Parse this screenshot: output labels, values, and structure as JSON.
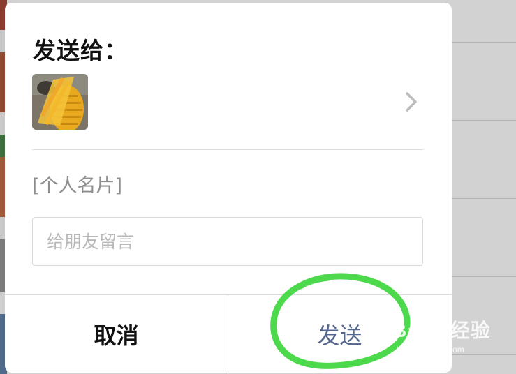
{
  "dialog": {
    "title": "发送给：",
    "card_prefix": "[个人名片]",
    "message_placeholder": "给朋友留言",
    "message_value": "",
    "buttons": {
      "cancel": "取消",
      "send": "发送"
    }
  },
  "watermark": {
    "brand": "Baidu经验",
    "sub": "jingyan.baidu.com"
  },
  "colors": {
    "send_text": "#56678f",
    "annotation": "#4cd94c",
    "overlay": "#d2d2d2"
  },
  "icons": {
    "chevron": "chevron-right-icon"
  }
}
